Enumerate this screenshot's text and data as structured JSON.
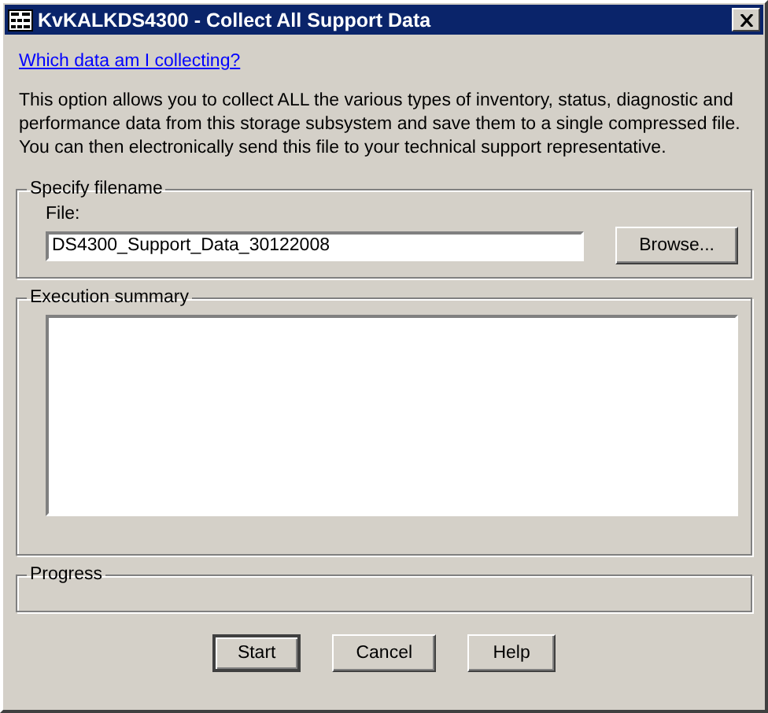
{
  "window": {
    "title": "KvKALKDS4300 - Collect All Support Data"
  },
  "help_link": "Which data am I collecting?",
  "description": "This option allows you to collect ALL the various types of inventory, status, diagnostic and performance data from this storage subsystem and save them to a single compressed file. You can then electronically send this file to your technical support representative.",
  "filename_group": {
    "title": "Specify filename",
    "label": "File:",
    "value": "DS4300_Support_Data_30122008",
    "browse": "Browse..."
  },
  "summary_group": {
    "title": "Execution summary"
  },
  "progress_group": {
    "title": "Progress"
  },
  "buttons": [
    {
      "label": "Start",
      "default": true
    },
    {
      "label": "Cancel",
      "default": false
    },
    {
      "label": "Help",
      "default": false
    }
  ]
}
